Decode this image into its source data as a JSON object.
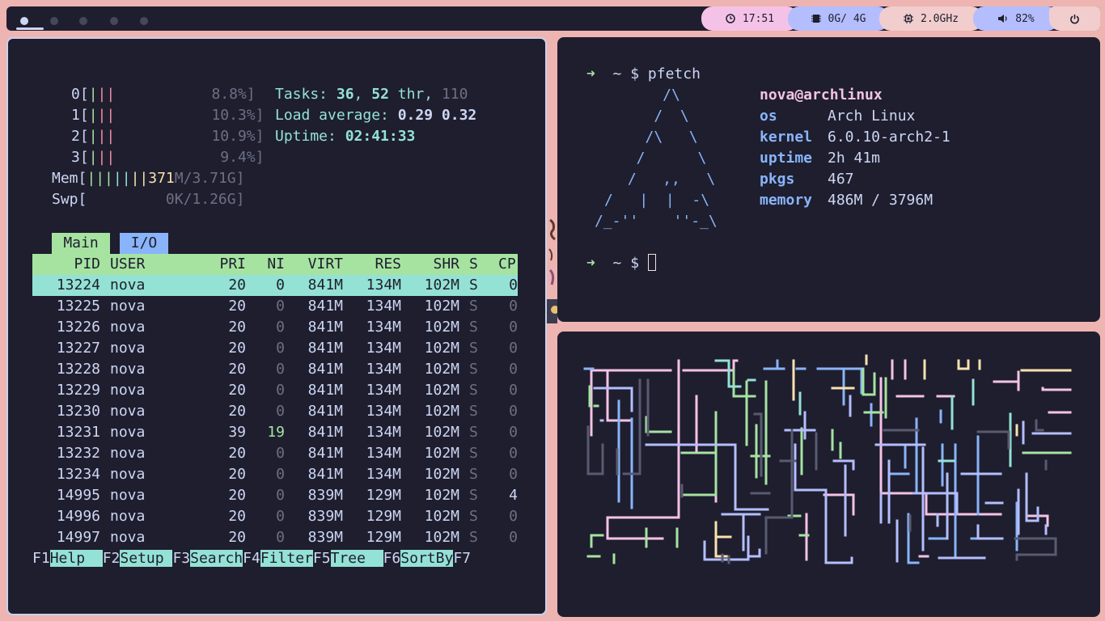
{
  "topbar": {
    "workspaces": [
      {
        "icon": "circle-filled",
        "active": true
      },
      {
        "icon": "circle",
        "active": false
      },
      {
        "icon": "circle",
        "active": false
      },
      {
        "icon": "circle",
        "active": false
      },
      {
        "icon": "circle",
        "active": false
      }
    ],
    "clock": {
      "icon": "clock-icon",
      "text": "17:51"
    },
    "memory": {
      "icon": "memory-chip-icon",
      "text": "0G/ 4G"
    },
    "cpu": {
      "icon": "cpu-icon",
      "text": "2.0GHz"
    },
    "volume": {
      "icon": "speaker-icon",
      "text": "82%"
    },
    "power": {
      "icon": "power-icon"
    },
    "colors": {
      "bar": "#1e1e2e",
      "pill_pink": "#f5c2e7",
      "pill_blue": "#b4befe",
      "pill_light": "#f2cdcd"
    }
  },
  "htop": {
    "cpus": [
      {
        "id": "0",
        "value": "8.8%]"
      },
      {
        "id": "1",
        "value": "10.3%]"
      },
      {
        "id": "2",
        "value": "10.9%]"
      },
      {
        "id": "3",
        "value": "9.4%]"
      }
    ],
    "mem": {
      "label": "Mem",
      "used": "371",
      "rest": "M/3.71G]"
    },
    "swp": {
      "label": "Swp",
      "value": "0K/1.26G]"
    },
    "tasks": {
      "label": "Tasks: ",
      "count": "36",
      "sep1": ", ",
      "thr": "52",
      "thr_label": " thr",
      "sep2": ", ",
      "running": "110"
    },
    "load": {
      "label": "Load average: ",
      "v1": "0.29",
      "v2": "0.32"
    },
    "uptime": {
      "label": "Uptime: ",
      "value": "02:41:33"
    },
    "tabs": [
      "Main",
      "I/O"
    ],
    "headers": {
      "pid": "PID",
      "user": "USER",
      "pri": "PRI",
      "ni": "NI",
      "virt": "VIRT",
      "res": "RES",
      "shr": "SHR",
      "s": "S",
      "cpu": "CP"
    },
    "rows": [
      {
        "pid": "13224",
        "user": "nova",
        "pri": "20",
        "ni": "0",
        "virt": "841M",
        "res": "134M",
        "shr": "102M",
        "s": "S",
        "cpu": "0"
      },
      {
        "pid": "13225",
        "user": "nova",
        "pri": "20",
        "ni": "0",
        "virt": "841M",
        "res": "134M",
        "shr": "102M",
        "s": "S",
        "cpu": "0"
      },
      {
        "pid": "13226",
        "user": "nova",
        "pri": "20",
        "ni": "0",
        "virt": "841M",
        "res": "134M",
        "shr": "102M",
        "s": "S",
        "cpu": "0"
      },
      {
        "pid": "13227",
        "user": "nova",
        "pri": "20",
        "ni": "0",
        "virt": "841M",
        "res": "134M",
        "shr": "102M",
        "s": "S",
        "cpu": "0"
      },
      {
        "pid": "13228",
        "user": "nova",
        "pri": "20",
        "ni": "0",
        "virt": "841M",
        "res": "134M",
        "shr": "102M",
        "s": "S",
        "cpu": "0"
      },
      {
        "pid": "13229",
        "user": "nova",
        "pri": "20",
        "ni": "0",
        "virt": "841M",
        "res": "134M",
        "shr": "102M",
        "s": "S",
        "cpu": "0"
      },
      {
        "pid": "13230",
        "user": "nova",
        "pri": "20",
        "ni": "0",
        "virt": "841M",
        "res": "134M",
        "shr": "102M",
        "s": "S",
        "cpu": "0"
      },
      {
        "pid": "13231",
        "user": "nova",
        "pri": "39",
        "ni": "19",
        "virt": "841M",
        "res": "134M",
        "shr": "102M",
        "s": "S",
        "cpu": "0"
      },
      {
        "pid": "13232",
        "user": "nova",
        "pri": "20",
        "ni": "0",
        "virt": "841M",
        "res": "134M",
        "shr": "102M",
        "s": "S",
        "cpu": "0"
      },
      {
        "pid": "13234",
        "user": "nova",
        "pri": "20",
        "ni": "0",
        "virt": "841M",
        "res": "134M",
        "shr": "102M",
        "s": "S",
        "cpu": "0"
      },
      {
        "pid": "14995",
        "user": "nova",
        "pri": "20",
        "ni": "0",
        "virt": "839M",
        "res": "129M",
        "shr": "102M",
        "s": "S",
        "cpu": "4"
      },
      {
        "pid": "14996",
        "user": "nova",
        "pri": "20",
        "ni": "0",
        "virt": "839M",
        "res": "129M",
        "shr": "102M",
        "s": "S",
        "cpu": "0"
      },
      {
        "pid": "14997",
        "user": "nova",
        "pri": "20",
        "ni": "0",
        "virt": "839M",
        "res": "129M",
        "shr": "102M",
        "s": "S",
        "cpu": "0"
      }
    ],
    "fkeys": [
      {
        "key": "F1",
        "label": "Help  "
      },
      {
        "key": "F2",
        "label": "Setup "
      },
      {
        "key": "F3",
        "label": "Search"
      },
      {
        "key": "F4",
        "label": "Filter"
      },
      {
        "key": "F5",
        "label": "Tree  "
      },
      {
        "key": "F6",
        "label": "SortBy"
      },
      {
        "key": "F7",
        "label": ""
      }
    ]
  },
  "terminal": {
    "prompt_arrow": "➜",
    "prompt_dir": "~ $",
    "command": "pfetch",
    "logo": [
      "     /\\",
      "    /  \\",
      "   /\\   \\",
      "  /      \\",
      " /   ,,   \\",
      "/   |  |  -\\",
      "/_-''    ''-_\\"
    ],
    "userhost": "nova@archlinux",
    "info": [
      {
        "key": "os",
        "value": "Arch Linux"
      },
      {
        "key": "kernel",
        "value": "6.0.10-arch2-1"
      },
      {
        "key": "uptime",
        "value": "2h 41m"
      },
      {
        "key": "pkgs",
        "value": "467"
      },
      {
        "key": "memory",
        "value": "486M / 3796M"
      }
    ]
  }
}
